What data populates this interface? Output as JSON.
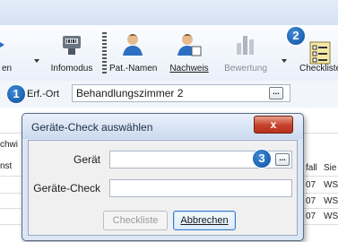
{
  "ribbon": {
    "partial_left_label": "en",
    "infomodus_label": "Infomodus",
    "pat_namen_label": "Pat.-Namen",
    "nachweis_label": "Nachweis",
    "bewertung_label": "Bewertung",
    "checkliste_label": "Checkliste"
  },
  "badges": {
    "one": "1",
    "two": "2",
    "three": "3"
  },
  "location": {
    "label": "Erf.-Ort",
    "value": "Behandlungszimmer 2",
    "ellipsis": "..."
  },
  "background_table": {
    "col_left_top": "chwi",
    "col_left_bottom": "nst",
    "col_right1": "fall",
    "col_right2": "Sie",
    "rows": [
      {
        "c1": "07",
        "c2": "WS"
      },
      {
        "c1": "07",
        "c2": "WS"
      },
      {
        "c1": "07",
        "c2": "WS"
      }
    ]
  },
  "dialog": {
    "title": "Geräte-Check auswählen",
    "close_glyph": "x",
    "geraet_label": "Gerät",
    "geraet_value": "",
    "ellipsis": "...",
    "geraetecheck_label": "Geräte-Check",
    "geraetecheck_value": "",
    "checkliste_button": "Checkliste",
    "abbrechen_button": "Abbrechen"
  }
}
